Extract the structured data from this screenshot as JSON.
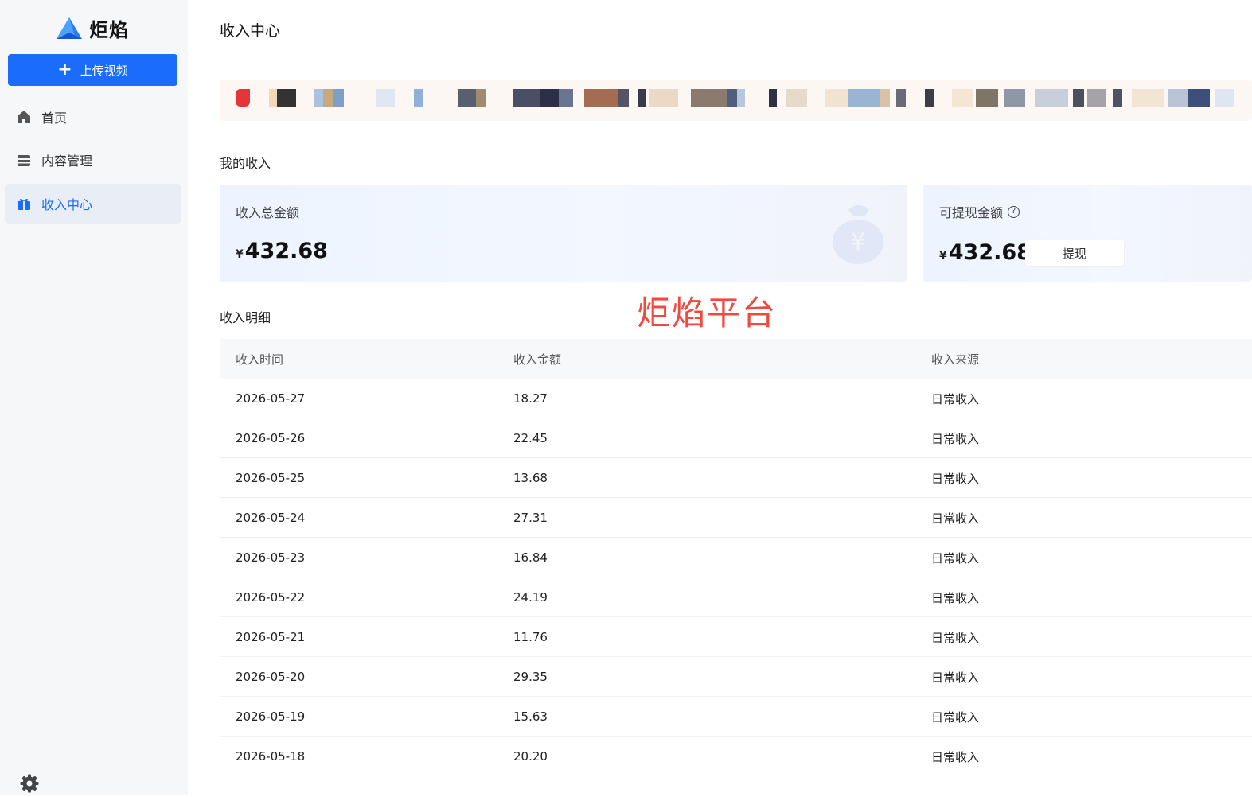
{
  "app": {
    "logo_text": "炬焰"
  },
  "sidebar": {
    "upload_label": "上传视频",
    "items": [
      {
        "label": "首页",
        "icon": "home-icon"
      },
      {
        "label": "内容管理",
        "icon": "folder-icon"
      },
      {
        "label": "收入中心",
        "icon": "gift-icon",
        "active": true
      }
    ]
  },
  "page": {
    "title": "收入中心"
  },
  "income": {
    "section_label": "我的收入",
    "total_label": "收入总金额",
    "total_currency": "¥",
    "total_amount": "432.68",
    "withdrawable_label": "可提现金额",
    "withdrawable_currency": "¥",
    "withdrawable_amount": "432.68",
    "withdraw_button": "提现"
  },
  "watermark": "炬焰平台",
  "details": {
    "section_label": "收入明细",
    "columns": [
      "收入时间",
      "收入金额",
      "收入来源"
    ],
    "rows": [
      [
        "2026-05-27",
        "18.27",
        "日常收入"
      ],
      [
        "2026-05-26",
        "22.45",
        "日常收入"
      ],
      [
        "2026-05-25",
        "13.68",
        "日常收入"
      ],
      [
        "2026-05-24",
        "27.31",
        "日常收入"
      ],
      [
        "2026-05-23",
        "16.84",
        "日常收入"
      ],
      [
        "2026-05-22",
        "24.19",
        "日常收入"
      ],
      [
        "2026-05-21",
        "11.76",
        "日常收入"
      ],
      [
        "2026-05-20",
        "29.35",
        "日常收入"
      ],
      [
        "2026-05-19",
        "15.63",
        "日常收入"
      ],
      [
        "2026-05-18",
        "20.20",
        "日常收入"
      ]
    ]
  },
  "colors": {
    "accent": "#1a6dfb",
    "watermark": "#f04a3f",
    "sidebar_bg": "#f6f7f9",
    "active_bg": "#e9edf6"
  }
}
